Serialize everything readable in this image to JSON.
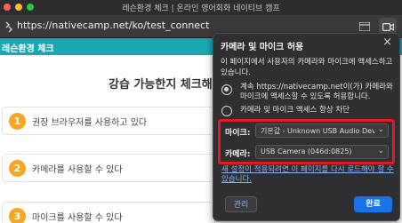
{
  "browser": {
    "window_title": "레슨환경 체크 | 온라인 영어회화 네이티브 캠프",
    "url": "https://nativecamp.net/ko/test_connect"
  },
  "page": {
    "top_bar_title": "레슨환경 체크",
    "heading": "강습 가능한지 체크해 보",
    "steps": [
      {
        "number": "1",
        "text": "권장 브라우저를 사용하고 있다"
      },
      {
        "number": "2",
        "text": "카메라를 사용할 수 있다"
      },
      {
        "number": "3",
        "text": "마이크를 사용할 수 있다"
      }
    ]
  },
  "permission_popup": {
    "title": "카메라 및 마이크 허용",
    "description": "이 페이지에서 사용자의 카메라와 마이크에 액세스하고 있습니다.",
    "option_allow": "계속 https://nativecamp.net이(가) 카메라와 마이크에 액세스할 수 있도록 허용합니다.",
    "option_block": "카메라 및 마이크 액세스 항상 차단",
    "mic_label": "마이크:",
    "mic_value": "기본값 - Unknown USB Audio Device",
    "camera_label": "카메라:",
    "camera_value": "USB Camera (046d:0825)",
    "reload_note": "새 설정이 적용되려면 이 페이지를 다시 로드해야 할 수 있습니다.",
    "manage_button": "관리",
    "done_button": "완료"
  },
  "colors": {
    "accent_teal": "#1aa7b4",
    "step_number": "#f5a623",
    "highlight_red": "#e01b24",
    "done_blue": "#1a73e8"
  }
}
